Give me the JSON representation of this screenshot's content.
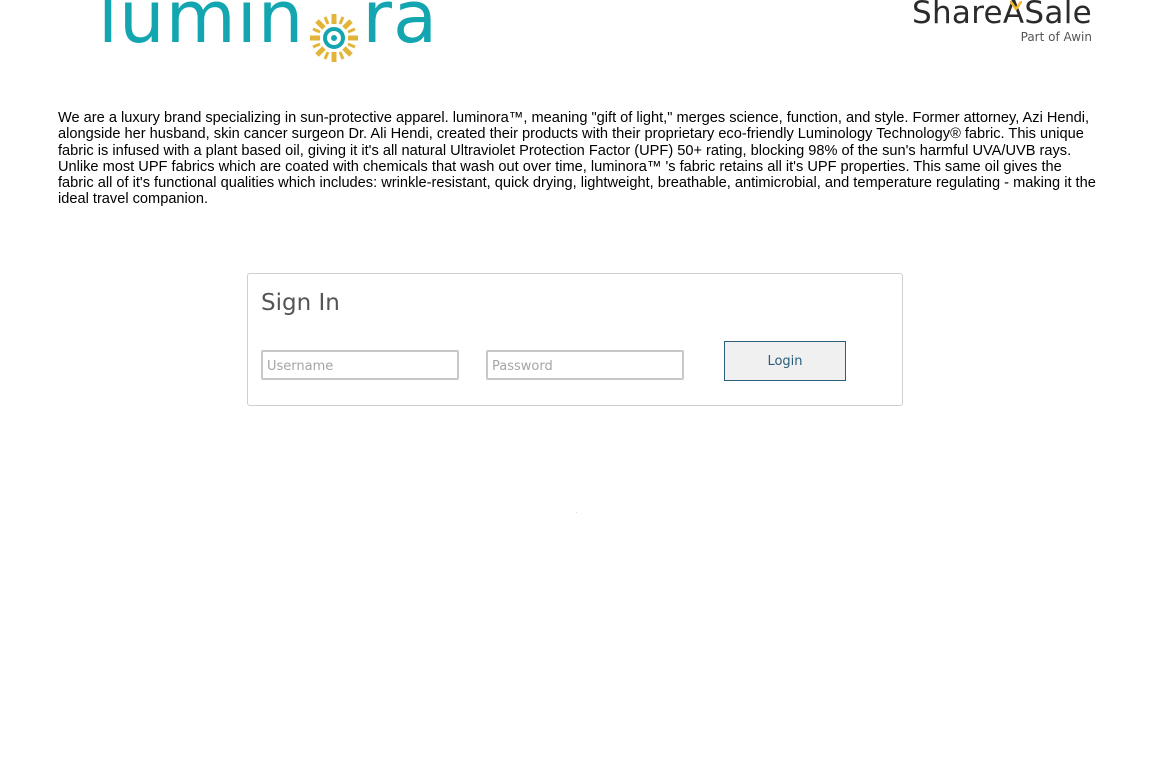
{
  "brand": {
    "wordmark_start": "lumin",
    "wordmark_end": "ra",
    "trademark": "™",
    "primary_color": "#14a6b0",
    "sun_color": "#e2b53a",
    "sun_icon": "sun-icon"
  },
  "partner": {
    "name": "ShareASale",
    "tagline": "Part of Awin",
    "spark_icon": "spark-icon",
    "spark_color": "#f1b82d"
  },
  "description": "We are a luxury brand specializing in sun-protective apparel. luminora™, meaning \"gift of light,\" merges science, function, and style. Former attorney, Azi Hendi, alongside her husband, skin cancer surgeon Dr. Ali Hendi, created their products with their proprietary eco-friendly Luminology Technology® fabric. This unique fabric is infused with a plant based oil, giving it it's all natural Ultraviolet Protection Factor (UPF) 50+ rating, blocking 98% of the sun's harmful UVA/UVB rays. Unlike most UPF fabrics which are coated with chemicals that wash out over time, luminora™ 's fabric retains all it's UPF properties. This same oil gives the fabric all of it's functional qualities which includes: wrinkle-resistant, quick drying, lightweight, breathable, antimicrobial, and temperature regulating - making it the ideal travel companion.",
  "signin": {
    "title": "Sign In",
    "username_placeholder": "Username",
    "username_value": "",
    "password_placeholder": "Password",
    "password_value": "",
    "login_label": "Login",
    "accent_color": "#2a5e7a"
  }
}
